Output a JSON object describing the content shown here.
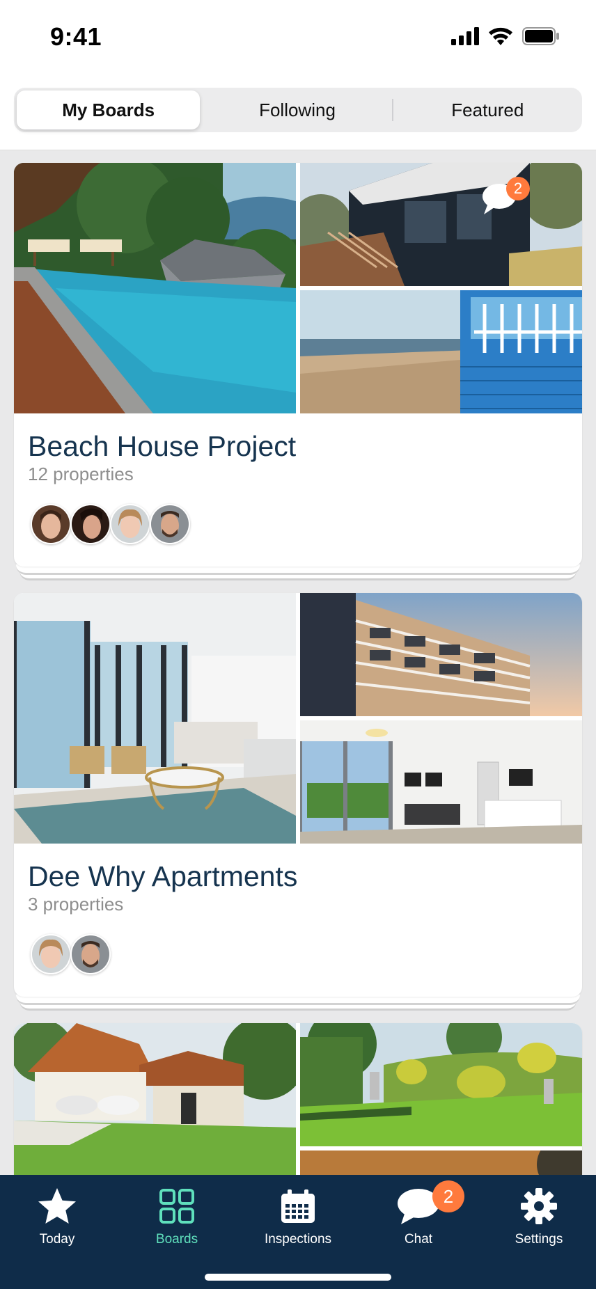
{
  "status_bar": {
    "time": "9:41"
  },
  "segments": [
    {
      "label": "My Boards",
      "active": true
    },
    {
      "label": "Following",
      "active": false
    },
    {
      "label": "Featured",
      "active": false
    }
  ],
  "boards": [
    {
      "title": "Beach House Project",
      "subtitle": "12 properties",
      "chat_badge": "2",
      "avatar_count": 4
    },
    {
      "title": "Dee Why Apartments",
      "subtitle": "3 properties",
      "avatar_count": 2
    },
    {
      "title": "",
      "subtitle": ""
    }
  ],
  "tabbar": {
    "items": [
      {
        "label": "Today",
        "icon": "star-icon"
      },
      {
        "label": "Boards",
        "icon": "grid-icon",
        "active": true
      },
      {
        "label": "Inspections",
        "icon": "calendar-icon"
      },
      {
        "label": "Chat",
        "icon": "chat-bubble-icon",
        "badge": "2"
      },
      {
        "label": "Settings",
        "icon": "gear-icon"
      }
    ]
  },
  "colors": {
    "accent": "#5fe0bc",
    "navy": "#0f2c49",
    "badge": "#ff7a3d",
    "title": "#16344f"
  }
}
